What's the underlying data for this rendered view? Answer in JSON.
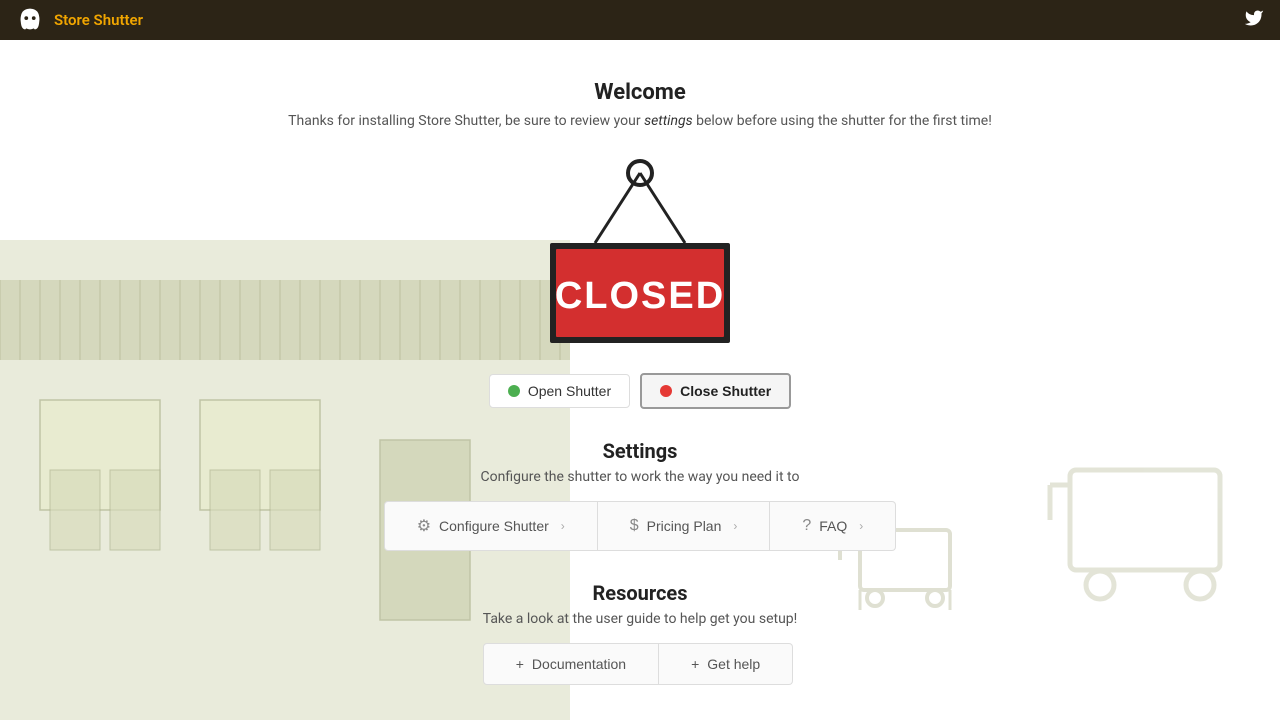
{
  "header": {
    "title": "Store Shutter",
    "logo_alt": "store-shutter-logo"
  },
  "welcome": {
    "title": "Welcome",
    "subtitle_pre": "Thanks for installing Store Shutter, be sure to review your ",
    "subtitle_link": "settings",
    "subtitle_post": " below before using the shutter for the first time!"
  },
  "shutter_toggle": {
    "open_label": "Open Shutter",
    "close_label": "Close Shutter"
  },
  "settings": {
    "title": "Settings",
    "subtitle": "Configure the shutter to work the way you need it to",
    "buttons": [
      {
        "label": "Configure Shutter",
        "icon": "⚙"
      },
      {
        "label": "Pricing Plan",
        "icon": "$"
      },
      {
        "label": "FAQ",
        "icon": "?"
      }
    ]
  },
  "resources": {
    "title": "Resources",
    "subtitle": "Take a look at the user guide to help get you setup!",
    "buttons": [
      {
        "label": "Documentation",
        "icon": "+"
      },
      {
        "label": "Get help",
        "icon": "+"
      }
    ]
  }
}
